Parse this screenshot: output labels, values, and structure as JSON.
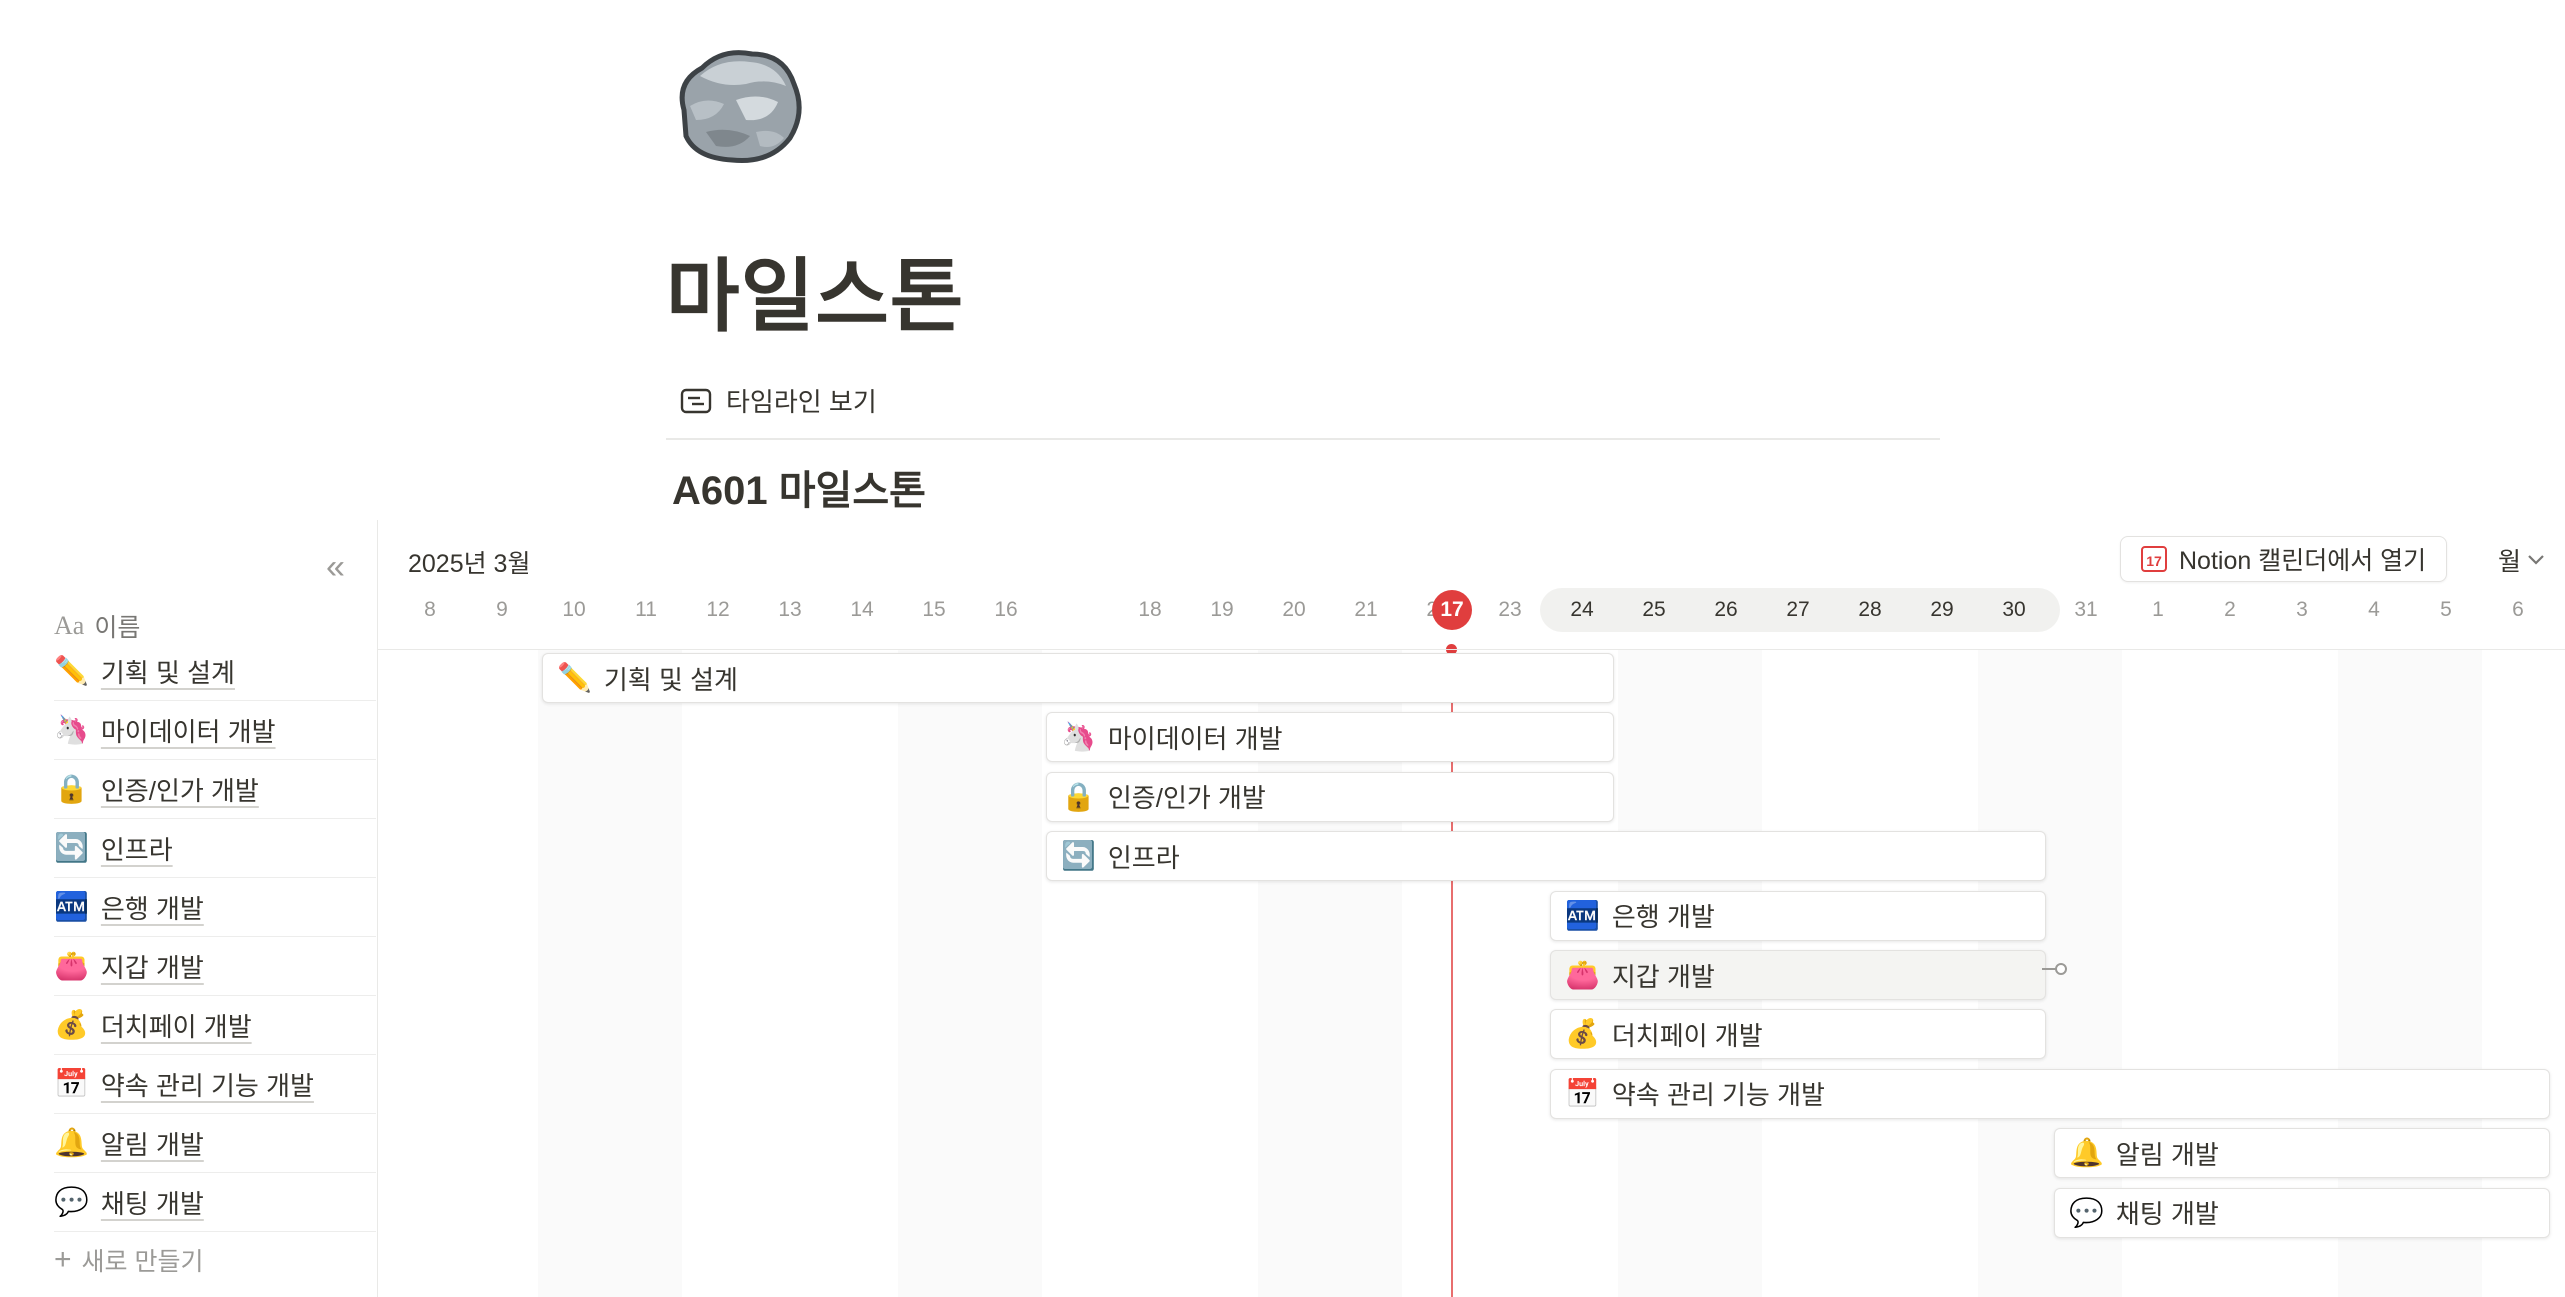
{
  "page": {
    "icon": "rock-icon",
    "title": "마일스톤",
    "view_tab": {
      "icon": "timeline-icon",
      "label": "타임라인 보기"
    },
    "database_title": "A601 마일스톤"
  },
  "timeline": {
    "month_label": "2025년 3월",
    "open_calendar": {
      "label": "Notion 캘린더에서 열기",
      "icon_text": "17"
    },
    "mode": "월",
    "today": "17",
    "column_header": {
      "icon": "Aa",
      "label": "이름"
    },
    "new_label": "새로 만들기",
    "days": [
      "8",
      "9",
      "10",
      "11",
      "12",
      "13",
      "14",
      "15",
      "16",
      "17",
      "18",
      "19",
      "20",
      "21",
      "22",
      "23",
      "24",
      "25",
      "26",
      "27",
      "28",
      "29",
      "30",
      "31",
      "1",
      "2",
      "3",
      "4",
      "5",
      "6"
    ],
    "highlighted_week": [
      "24",
      "25",
      "26",
      "27",
      "28",
      "29",
      "30"
    ],
    "items": [
      {
        "icon": "✏️",
        "name": "기획 및 설계",
        "start": "10",
        "end": "24"
      },
      {
        "icon": "🦄",
        "name": "마이데이터 개발",
        "start": "17",
        "end": "24"
      },
      {
        "icon": "🔒",
        "name": "인증/인가 개발",
        "start": "17",
        "end": "24"
      },
      {
        "icon": "🔄",
        "name": "인프라",
        "start": "17",
        "end": "30"
      },
      {
        "icon": "🏧",
        "name": "은행 개발",
        "start": "24",
        "end": "30"
      },
      {
        "icon": "👛",
        "name": "지갑 개발",
        "start": "24",
        "end": "30"
      },
      {
        "icon": "💰",
        "name": "더치페이 개발",
        "start": "24",
        "end": "30"
      },
      {
        "icon": "📅",
        "name": "약속 관리 기능 개발",
        "start": "24",
        "end": "6"
      },
      {
        "icon": "🔔",
        "name": "알림 개발",
        "start": "31",
        "end": "6"
      },
      {
        "icon": "💬",
        "name": "채팅 개발",
        "start": "31",
        "end": "6"
      }
    ]
  }
}
